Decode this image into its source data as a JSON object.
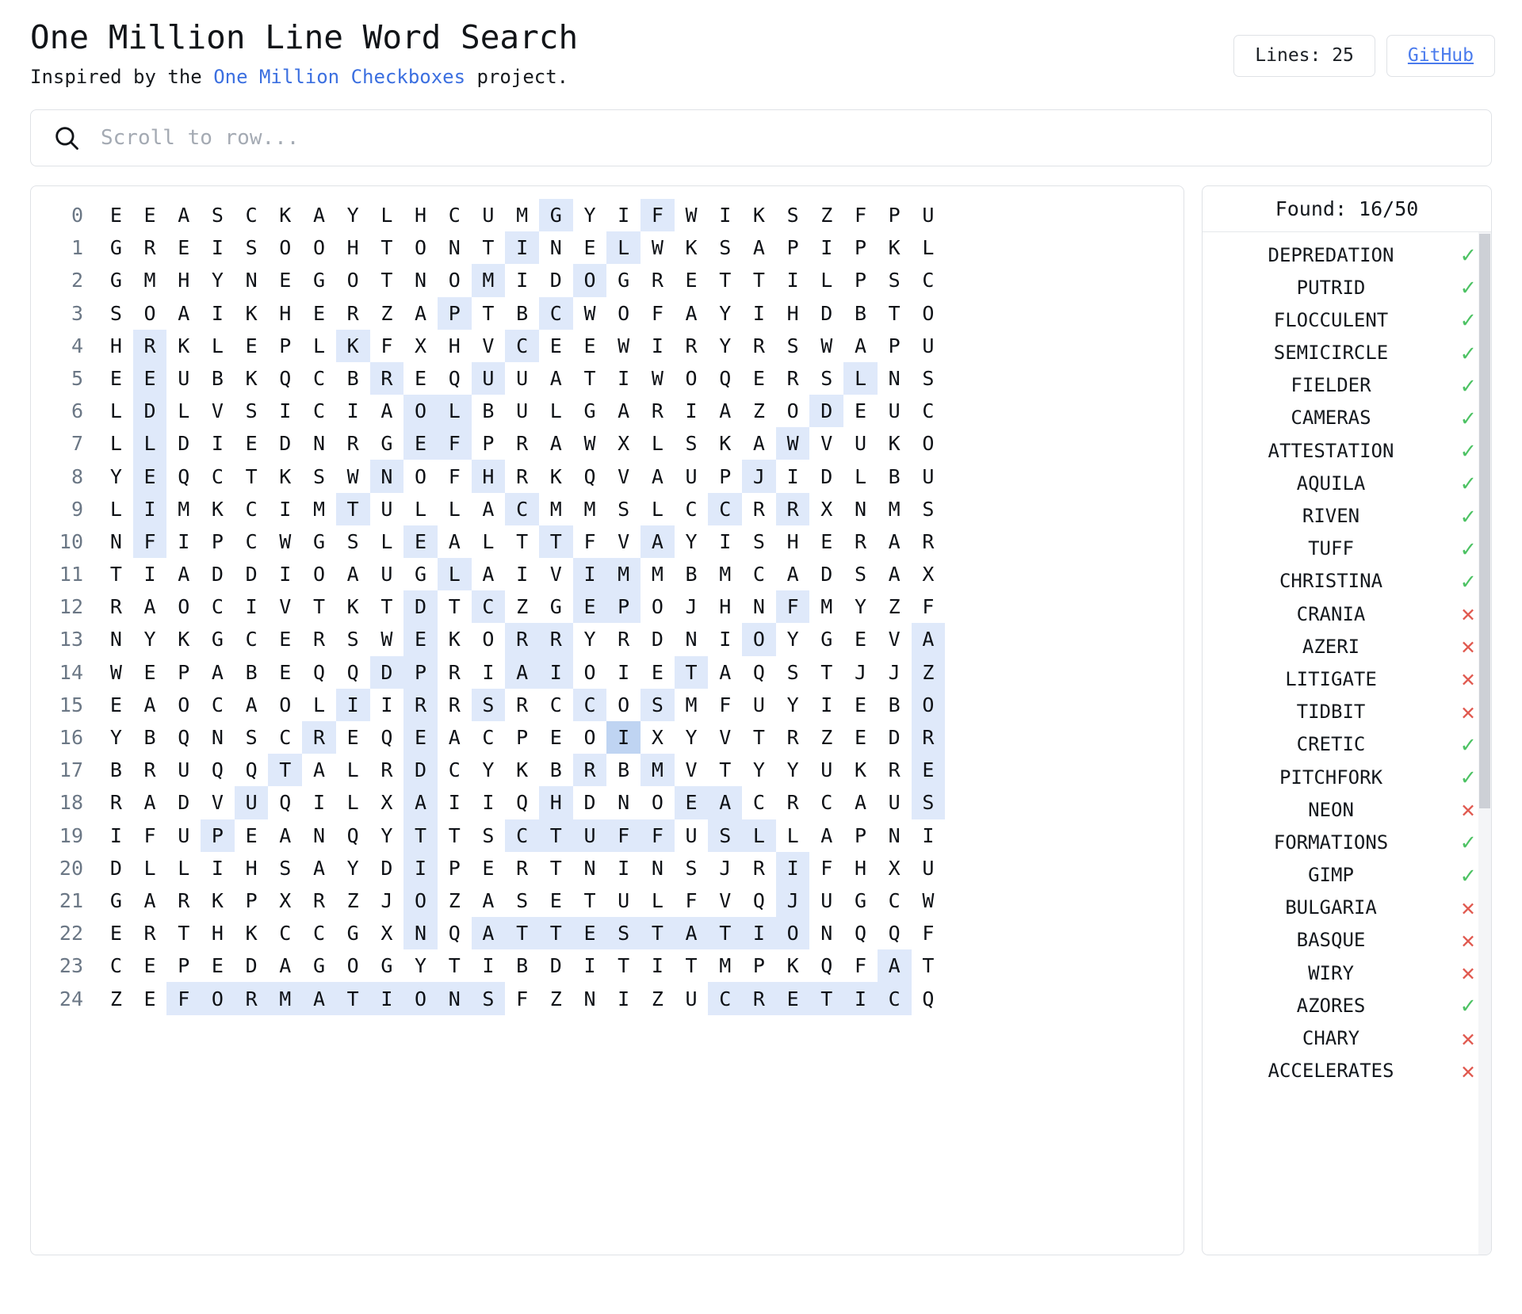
{
  "header": {
    "title": "One Million Line Word Search",
    "subtitle_prefix": "Inspired by the ",
    "subtitle_link": "One Million Checkboxes",
    "subtitle_suffix": " project.",
    "lines_chip": "Lines: 25",
    "github_chip": "GitHub"
  },
  "search": {
    "icon": "search-icon",
    "placeholder": "Scroll to row...",
    "value": ""
  },
  "words_panel": {
    "found_label": "Found: 16/50",
    "found_count": 16,
    "total_count": 50,
    "mark_found": "✓",
    "mark_missing": "✕",
    "accent_found": "#4cc263",
    "accent_missing": "#e0584e",
    "items": [
      {
        "word": "DEPREDATION",
        "found": true
      },
      {
        "word": "PUTRID",
        "found": true
      },
      {
        "word": "FLOCCULENT",
        "found": true
      },
      {
        "word": "SEMICIRCLE",
        "found": true
      },
      {
        "word": "FIELDER",
        "found": true
      },
      {
        "word": "CAMERAS",
        "found": true
      },
      {
        "word": "ATTESTATION",
        "found": true
      },
      {
        "word": "AQUILA",
        "found": true
      },
      {
        "word": "RIVEN",
        "found": true
      },
      {
        "word": "TUFF",
        "found": true
      },
      {
        "word": "CHRISTINA",
        "found": true
      },
      {
        "word": "CRANIA",
        "found": false
      },
      {
        "word": "AZERI",
        "found": false
      },
      {
        "word": "LITIGATE",
        "found": false
      },
      {
        "word": "TIDBIT",
        "found": false
      },
      {
        "word": "CRETIC",
        "found": true
      },
      {
        "word": "PITCHFORK",
        "found": true
      },
      {
        "word": "NEON",
        "found": false
      },
      {
        "word": "FORMATIONS",
        "found": true
      },
      {
        "word": "GIMP",
        "found": true
      },
      {
        "word": "BULGARIA",
        "found": false
      },
      {
        "word": "BASQUE",
        "found": false
      },
      {
        "word": "WIRY",
        "found": false
      },
      {
        "word": "AZORES",
        "found": true
      },
      {
        "word": "CHARY",
        "found": false
      },
      {
        "word": "ACCELERATES",
        "found": false
      }
    ]
  },
  "grid": {
    "highlight_color": "#dfe9fa",
    "highlight_active_color": "#bfd4f2",
    "columns": 24,
    "rows": [
      {
        "n": "0",
        "letters": "EEASCKAYLHCUMGYIFWIKSZFPU",
        "hl": [
          13,
          16
        ],
        "hl2": []
      },
      {
        "n": "1",
        "letters": "GREISOOHTONTINELWKSAPIPKL",
        "hl": [
          12,
          15
        ],
        "hl2": []
      },
      {
        "n": "2",
        "letters": "GMHYNEGOTNOMIDOGRETTILPSC",
        "hl": [
          11,
          14
        ],
        "hl2": []
      },
      {
        "n": "3",
        "letters": "SOAIKHERZAPTBCWOFAYIHDBTO",
        "hl": [
          10,
          13
        ],
        "hl2": []
      },
      {
        "n": "4",
        "letters": "HRKLEPLKFXHVCEEWIRYRSWAPU",
        "hl": [
          1,
          7,
          12
        ],
        "hl2": []
      },
      {
        "n": "5",
        "letters": "EEUBKQCBREQUUATIWOQERSLNS",
        "hl": [
          1,
          8,
          11,
          22
        ],
        "hl2": []
      },
      {
        "n": "6",
        "letters": "LDLVSICIAOLBULGARIAZODEUC",
        "hl": [
          1,
          9,
          10,
          21
        ],
        "hl2": []
      },
      {
        "n": "7",
        "letters": "LLDIEDNRGEFPRAWXLSKAWVUKO",
        "hl": [
          1,
          9,
          10,
          20
        ],
        "hl2": []
      },
      {
        "n": "8",
        "letters": "YEQCTKSWNOFHRKQVAUPJIDLBU",
        "hl": [
          1,
          8,
          11,
          19
        ],
        "hl2": []
      },
      {
        "n": "9",
        "letters": "LIMKCIMTULLACMMSLCCRRXNMS",
        "hl": [
          1,
          7,
          12,
          18,
          20
        ],
        "hl2": []
      },
      {
        "n": "10",
        "letters": "NFIPCWGSLEALTTFVAYISHERAR",
        "hl": [
          1,
          9,
          13,
          16
        ],
        "hl2": []
      },
      {
        "n": "11",
        "letters": "TIADDIOAUGLAIVIMMBMCADSAX",
        "hl": [
          10,
          14,
          15
        ],
        "hl2": []
      },
      {
        "n": "12",
        "letters": "RAOCIVTKTDTCZGEPOJHNFMYZF",
        "hl": [
          9,
          11,
          14,
          15,
          20
        ],
        "hl2": []
      },
      {
        "n": "13",
        "letters": "NYKGCERSWEKORRYRDNIOYGEVA",
        "hl": [
          9,
          12,
          13,
          19,
          24
        ],
        "hl2": []
      },
      {
        "n": "14",
        "letters": "WEPABEQQDPRIAIOIETAQSTJJZ",
        "hl": [
          8,
          9,
          12,
          13,
          17,
          24
        ],
        "hl2": []
      },
      {
        "n": "15",
        "letters": "EAOCAOLIIRRSRCCOSMFUYIEBO",
        "hl": [
          7,
          9,
          11,
          14,
          16,
          24
        ],
        "hl2": []
      },
      {
        "n": "16",
        "letters": "YBQNSCREQEACPEOIXYVTRZEDR",
        "hl": [
          6,
          9,
          24
        ],
        "hl2": [
          15
        ]
      },
      {
        "n": "17",
        "letters": "BRUQQTALRDCYKBRBMVTYYUKRE",
        "hl": [
          5,
          9,
          14,
          16,
          24
        ],
        "hl2": []
      },
      {
        "n": "18",
        "letters": "RADVUQILXAIIQHDNOEACRCAUS",
        "hl": [
          4,
          9,
          13,
          17,
          18,
          24
        ],
        "hl2": []
      },
      {
        "n": "19",
        "letters": "IFUPEANQYTTSCTUFFUSLLAPNI",
        "hl": [
          3,
          9,
          12,
          13,
          14,
          15,
          16,
          18,
          19
        ],
        "hl2": []
      },
      {
        "n": "20",
        "letters": "DLLIHSAYDIPERTNINSJRIFHXU",
        "hl": [
          9,
          20
        ],
        "hl2": []
      },
      {
        "n": "21",
        "letters": "GARKPXRZJOZASETULFVQJUGCW",
        "hl": [
          9,
          20
        ],
        "hl2": []
      },
      {
        "n": "22",
        "letters": "ERTHKCCGXNQATTESTATIONQQF",
        "hl": [
          9,
          11,
          12,
          13,
          14,
          15,
          16,
          17,
          18,
          19,
          20
        ],
        "hl2": []
      },
      {
        "n": "23",
        "letters": "CEPEDAGOGYTIBDITITMPKQFAT",
        "hl": [
          23
        ],
        "hl2": []
      },
      {
        "n": "24",
        "letters": "ZEFORMATIONSFZNIZUCRETICQ",
        "hl": [
          2,
          3,
          4,
          5,
          6,
          7,
          8,
          9,
          10,
          11,
          18,
          19,
          20,
          21,
          22,
          23
        ],
        "hl2": []
      }
    ]
  }
}
